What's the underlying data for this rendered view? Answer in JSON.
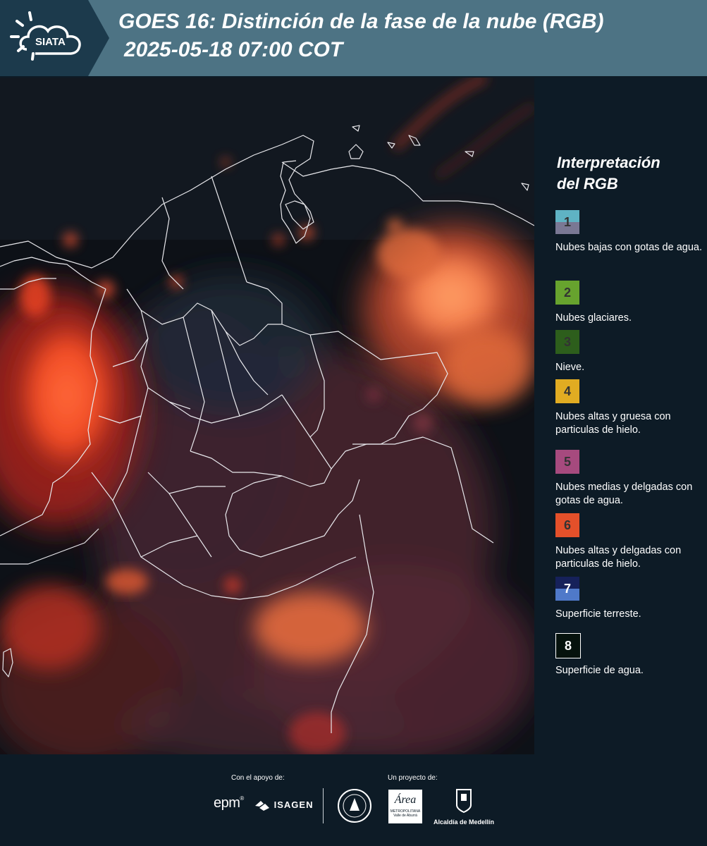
{
  "header": {
    "logo_text": "SIATA",
    "title_line1": "GOES 16: Distinción de la fase de la nube (RGB)",
    "title_line2": "2025-05-18 07:00 COT"
  },
  "legend": {
    "title_line1": "Interpretación",
    "title_line2": "del RGB",
    "items": [
      {
        "number": "1",
        "label": "Nubes bajas con gotas de agua.",
        "color_top": "#5fb3c4",
        "color_bottom": "#7a7894"
      },
      {
        "number": "2",
        "label": "Nubes glaciares.",
        "color_top": "#67a32e",
        "color_bottom": "#67a32e"
      },
      {
        "number": "3",
        "label": "Nieve.",
        "color_top": "#2d5e1c",
        "color_bottom": "#2d5e1c"
      },
      {
        "number": "4",
        "label": "Nubes altas y gruesa con particulas de hielo.",
        "color_top": "#e1ac22",
        "color_bottom": "#e1ac22"
      },
      {
        "number": "5",
        "label": "Nubes medias y delgadas con gotas de agua.",
        "color_top": "#a64a7e",
        "color_bottom": "#a64a7e"
      },
      {
        "number": "6",
        "label": "Nubes altas y delgadas con particulas de hielo.",
        "color_top": "#e4502a",
        "color_bottom": "#e4502a"
      },
      {
        "number": "7",
        "label": "Superficie terreste.",
        "color_top": "#16215a",
        "color_bottom": "#4f79c9"
      },
      {
        "number": "8",
        "label": "Superficie de agua.",
        "color_top": "#06120d",
        "color_bottom": "#06120d"
      }
    ]
  },
  "footer": {
    "support_label": "Con el apoyo de:",
    "project_label": "Un proyecto de:",
    "sponsor_epm": "epm",
    "sponsor_isagen": "ISAGEN",
    "partner_area_line1": "Área",
    "partner_area_line2": "METROPOLITANA",
    "partner_area_line3": "Valle de Aburrá",
    "partner_medellin": "Alcaldía de Medellín"
  }
}
